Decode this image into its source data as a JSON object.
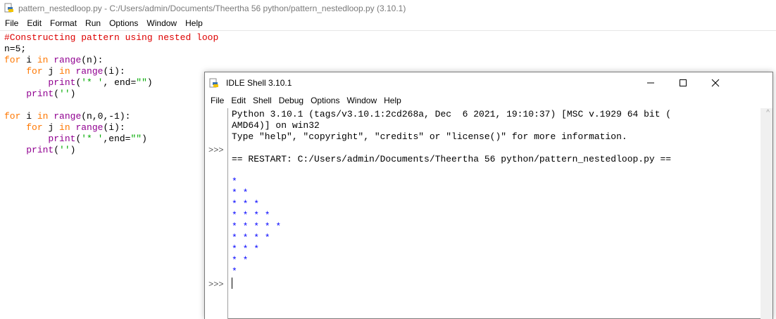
{
  "editor_window": {
    "title": "pattern_nestedloop.py - C:/Users/admin/Documents/Theertha 56 python/pattern_nestedloop.py (3.10.1)",
    "menu": [
      "File",
      "Edit",
      "Format",
      "Run",
      "Options",
      "Window",
      "Help"
    ]
  },
  "code": {
    "l1": "#Constructing pattern using nested loop",
    "l2": "n=5;",
    "kw_for": "for",
    "kw_in": "in",
    "bi_range": "range",
    "bi_print": "print"
  },
  "shell_window": {
    "title": "IDLE Shell 3.10.1",
    "menu": [
      "File",
      "Edit",
      "Shell",
      "Debug",
      "Options",
      "Window",
      "Help"
    ],
    "prompt": ">>>",
    "banner1": "Python 3.10.1 (tags/v3.10.1:2cd268a, Dec  6 2021, 19:10:37) [MSC v.1929 64 bit (",
    "banner2": "AMD64)] on win32",
    "banner3": "Type \"help\", \"copyright\", \"credits\" or \"license()\" for more information.",
    "restart": "== RESTART: C:/Users/admin/Documents/Theertha 56 python/pattern_nestedloop.py ==",
    "output": [
      "*",
      "* *",
      "* * *",
      "* * * *",
      "* * * * *",
      "* * * *",
      "* * *",
      "* *",
      "*"
    ]
  },
  "colors": {
    "keyword": "#ff7700",
    "builtin": "#900090",
    "string": "#00aa00",
    "comment": "#dd0000",
    "output": "#0000ff"
  }
}
